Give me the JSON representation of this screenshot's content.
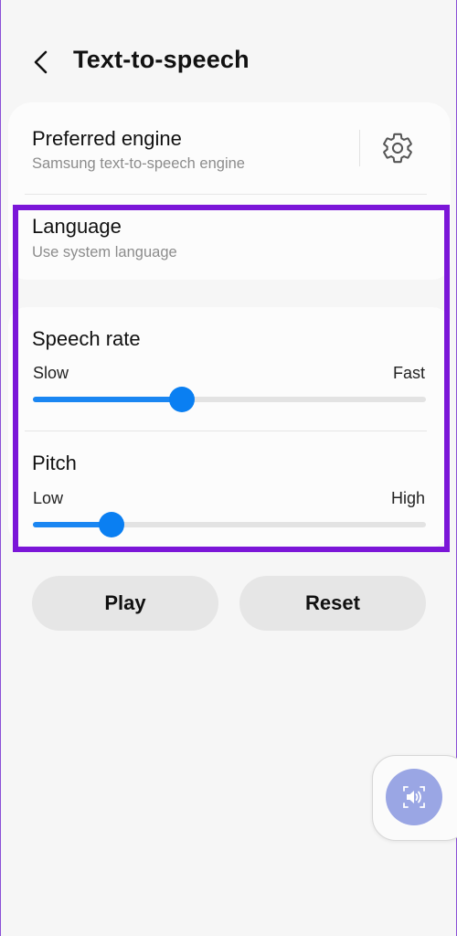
{
  "header": {
    "title": "Text-to-speech"
  },
  "engine": {
    "title": "Preferred engine",
    "subtitle": "Samsung text-to-speech engine"
  },
  "language": {
    "title": "Language",
    "subtitle": "Use system language"
  },
  "speech_rate": {
    "title": "Speech rate",
    "min_label": "Slow",
    "max_label": "Fast",
    "value": 0.38
  },
  "pitch": {
    "title": "Pitch",
    "min_label": "Low",
    "max_label": "High",
    "value": 0.2
  },
  "buttons": {
    "play": "Play",
    "reset": "Reset"
  },
  "icons": {
    "back": "back-arrow-icon",
    "settings": "gear-icon",
    "floating": "speaker-icon"
  },
  "colors": {
    "accent": "#0a7ff2",
    "highlight": "#7b16d8",
    "floating_button": "#9aa6e4"
  }
}
